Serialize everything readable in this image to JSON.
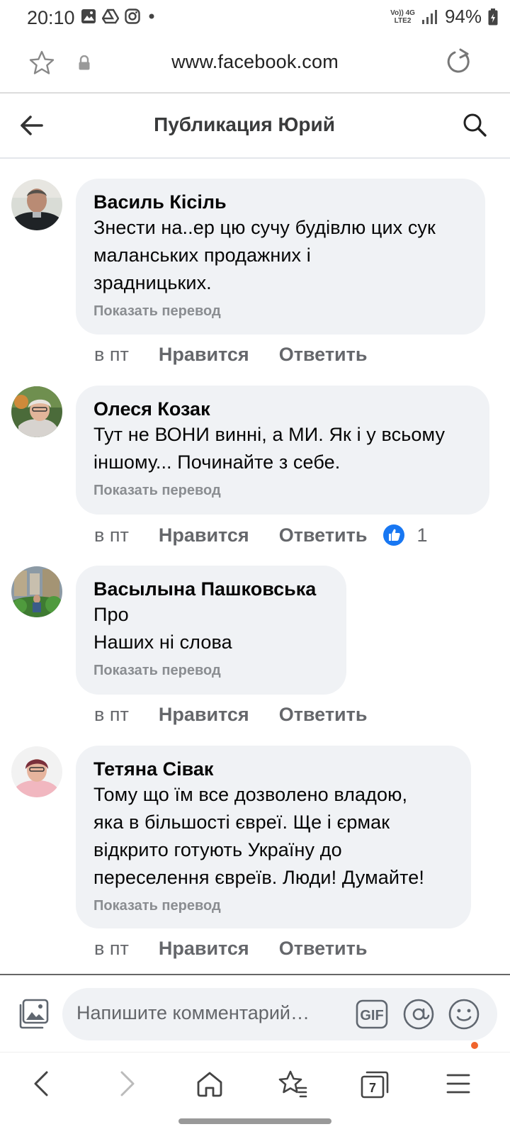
{
  "status_bar": {
    "time": "20:10",
    "network_top": "Vo)) 4G",
    "network_bottom": "LTE2",
    "battery": "94%"
  },
  "browser": {
    "url": "www.facebook.com"
  },
  "header": {
    "title": "Публикация Юрий"
  },
  "comments": [
    {
      "author": "Василь Кісіль",
      "text": "Знести на..ер цю сучу будівлю цих сук\nмаланських продажних і\nзрадницьких.",
      "translate": "Показать перевод",
      "time": "в пт",
      "like": "Нравится",
      "reply": "Ответить"
    },
    {
      "author": "Олеся Козак",
      "text": "Тут не ВОНИ винні, а МИ. Як і у всьому\nіншому... Починайте з себе.",
      "translate": "Показать перевод",
      "time": "в пт",
      "like": "Нравится",
      "reply": "Ответить",
      "reaction_count": "1"
    },
    {
      "author": "Васылына Пашковська",
      "text": "Про\nНаших ні слова",
      "translate": "Показать перевод",
      "time": "в пт",
      "like": "Нравится",
      "reply": "Ответить"
    },
    {
      "author": "Тетяна Сівак",
      "text": "Тому що їм все дозволено владою,\nяка  в більшості євреї. Ще і єрмак\nвідкрито готують Україну до\nпереселення євреїв. Люди! Думайте!",
      "translate": "Показать перевод",
      "time": "в пт",
      "like": "Нравится",
      "reply": "Ответить"
    }
  ],
  "composer": {
    "placeholder": "Напишите комментарий…",
    "gif_label": "GIF"
  },
  "bottom_nav": {
    "tabs_count": "7"
  },
  "icons": {
    "like_reaction": "like-reaction-icon",
    "accent": "#1877f2"
  }
}
